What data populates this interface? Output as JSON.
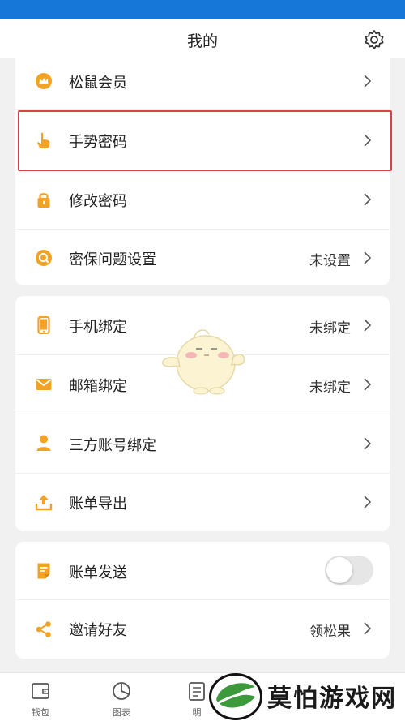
{
  "header": {
    "title": "我的",
    "settings_icon": "gear-icon"
  },
  "card1": {
    "items": [
      {
        "label": "松鼠会员",
        "icon": "crown-icon",
        "value": ""
      },
      {
        "label": "手势密码",
        "icon": "hand-pointer-icon",
        "value": ""
      },
      {
        "label": "修改密码",
        "icon": "lock-icon",
        "value": ""
      },
      {
        "label": "密保问题设置",
        "icon": "question-q-icon",
        "value": "未设置"
      }
    ]
  },
  "card2": {
    "items": [
      {
        "label": "手机绑定",
        "icon": "phone-icon",
        "value": "未绑定"
      },
      {
        "label": "邮箱绑定",
        "icon": "envelope-icon",
        "value": "未绑定"
      },
      {
        "label": "三方账号绑定",
        "icon": "person-icon",
        "value": ""
      },
      {
        "label": "账单导出",
        "icon": "upload-icon",
        "value": ""
      }
    ]
  },
  "card3": {
    "items": [
      {
        "label": "账单发送",
        "icon": "document-icon",
        "toggle_on": false
      },
      {
        "label": "邀请好友",
        "icon": "share-icon",
        "value": "领松果"
      }
    ]
  },
  "tabbar": {
    "tabs": [
      {
        "label": "钱包",
        "icon": "wallet-icon"
      },
      {
        "label": "图表",
        "icon": "pie-chart-icon"
      },
      {
        "label": "明",
        "icon": "detail-icon"
      }
    ]
  },
  "watermark": {
    "text": "莫怕游戏网"
  },
  "colors": {
    "accent": "#f2a325",
    "status_bar": "#1677d9",
    "highlight_border": "#d64545"
  }
}
